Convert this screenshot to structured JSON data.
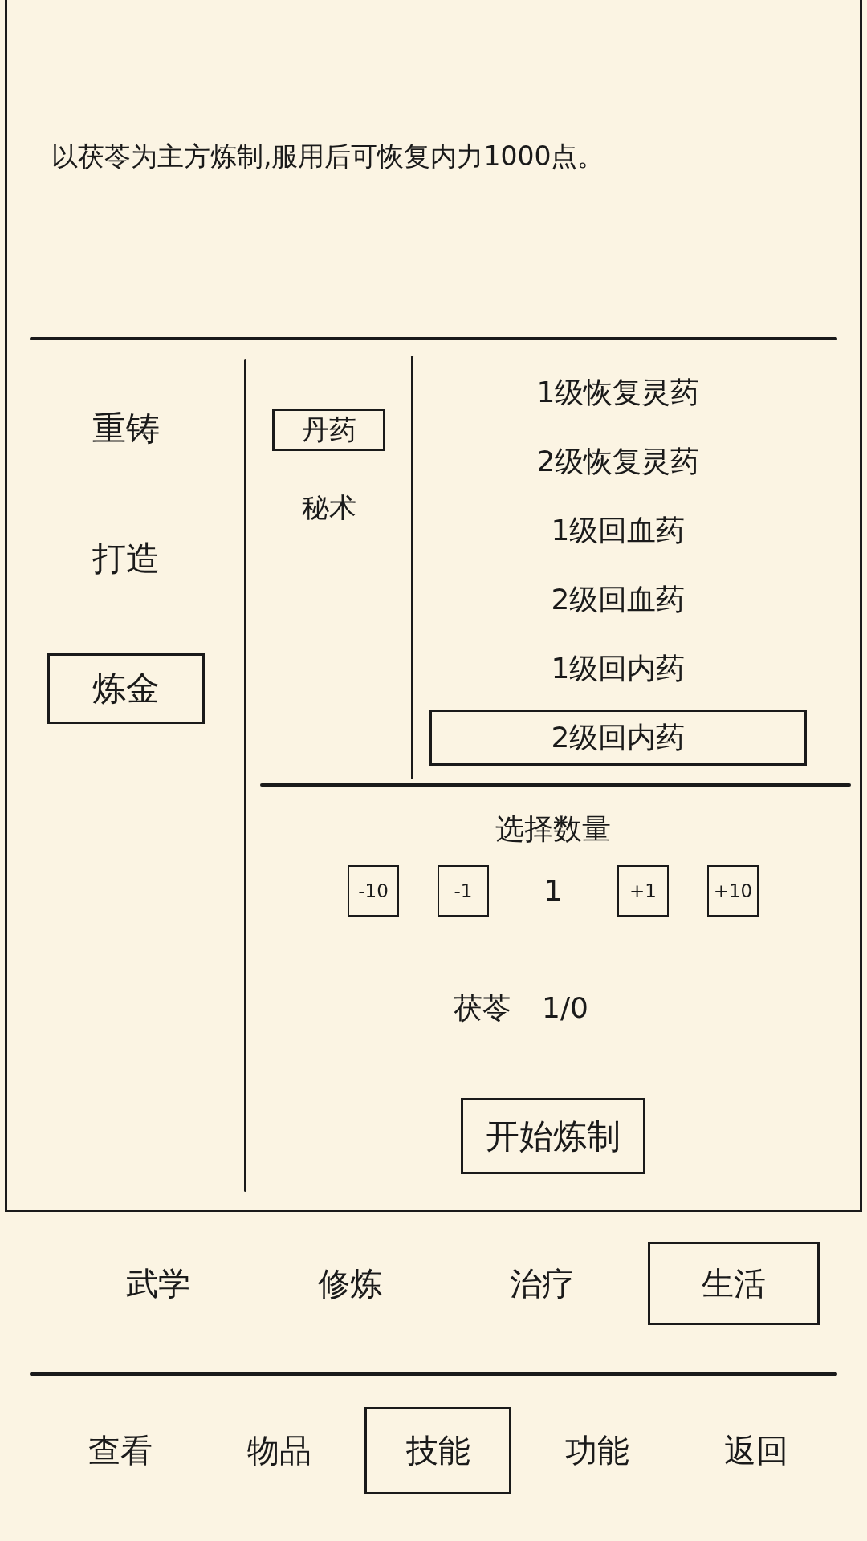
{
  "description": "以茯苓为主方炼制,服用后可恢复内力1000点。",
  "crafts": [
    {
      "label": "重铸",
      "selected": false
    },
    {
      "label": "打造",
      "selected": false
    },
    {
      "label": "炼金",
      "selected": true
    }
  ],
  "categories": [
    {
      "label": "丹药",
      "selected": true
    },
    {
      "label": "秘术",
      "selected": false
    }
  ],
  "recipes": [
    {
      "label": "1级恢复灵药",
      "selected": false
    },
    {
      "label": "2级恢复灵药",
      "selected": false
    },
    {
      "label": "1级回血药",
      "selected": false
    },
    {
      "label": "2级回血药",
      "selected": false
    },
    {
      "label": "1级回内药",
      "selected": false
    },
    {
      "label": "2级回内药",
      "selected": true
    }
  ],
  "quantity": {
    "title": "选择数量",
    "controls": [
      {
        "kind": "button",
        "label": "-10"
      },
      {
        "kind": "button",
        "label": "-1"
      },
      {
        "kind": "value",
        "label": "1"
      },
      {
        "kind": "button",
        "label": "+1"
      },
      {
        "kind": "button",
        "label": "+10"
      }
    ]
  },
  "materials": [
    {
      "name": "茯苓",
      "count": "1/0"
    }
  ],
  "start_button": "开始炼制",
  "skill_tabs": [
    {
      "label": "武学",
      "selected": false
    },
    {
      "label": "修炼",
      "selected": false
    },
    {
      "label": "治疗",
      "selected": false
    },
    {
      "label": "生活",
      "selected": true
    }
  ],
  "nav": [
    {
      "label": "查看",
      "selected": false
    },
    {
      "label": "物品",
      "selected": false
    },
    {
      "label": "技能",
      "selected": true
    },
    {
      "label": "功能",
      "selected": false
    },
    {
      "label": "返回",
      "selected": false
    }
  ]
}
